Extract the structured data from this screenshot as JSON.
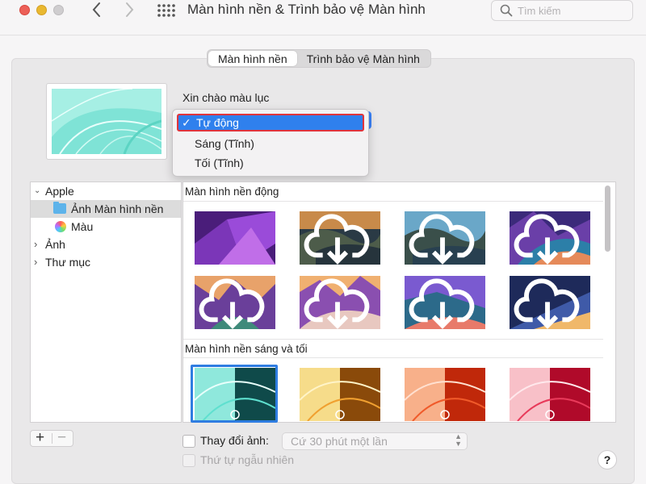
{
  "window": {
    "title": "Màn hình nền & Trình bảo vệ Màn hình",
    "search_placeholder": "Tìm kiếm"
  },
  "tabs": [
    {
      "label": "Màn hình nền",
      "active": true
    },
    {
      "label": "Trình bảo vệ Màn hình",
      "active": false
    }
  ],
  "wallpaper": {
    "name": "Xin chào màu lục"
  },
  "appearance_menu": {
    "items": [
      {
        "label": "Tự động",
        "checked": true
      },
      {
        "label": "Sáng (Tĩnh)",
        "checked": false
      },
      {
        "label": "Tối (Tĩnh)",
        "checked": false
      }
    ],
    "check_mark": "✓"
  },
  "sidebar": {
    "items": [
      {
        "label": "Apple",
        "expanded": true
      },
      {
        "label": "Ảnh Màn hình nền",
        "selected": true
      },
      {
        "label": "Màu"
      },
      {
        "label": "Ảnh",
        "expanded": false
      },
      {
        "label": "Thư mục",
        "expanded": false
      }
    ]
  },
  "sections": [
    {
      "title": "Màn hình nền động"
    },
    {
      "title": "Màn hình nền sáng và tối"
    }
  ],
  "controls": {
    "add": "+",
    "remove": "−",
    "change_picture_label": "Thay đổi ảnh:",
    "change_interval": "Cứ 30 phút một lần",
    "random_order_label": "Thứ tự ngẫu nhiên",
    "help": "?"
  },
  "colors": {
    "accent": "#2f80ed",
    "highlight_border": "#e0343c"
  }
}
